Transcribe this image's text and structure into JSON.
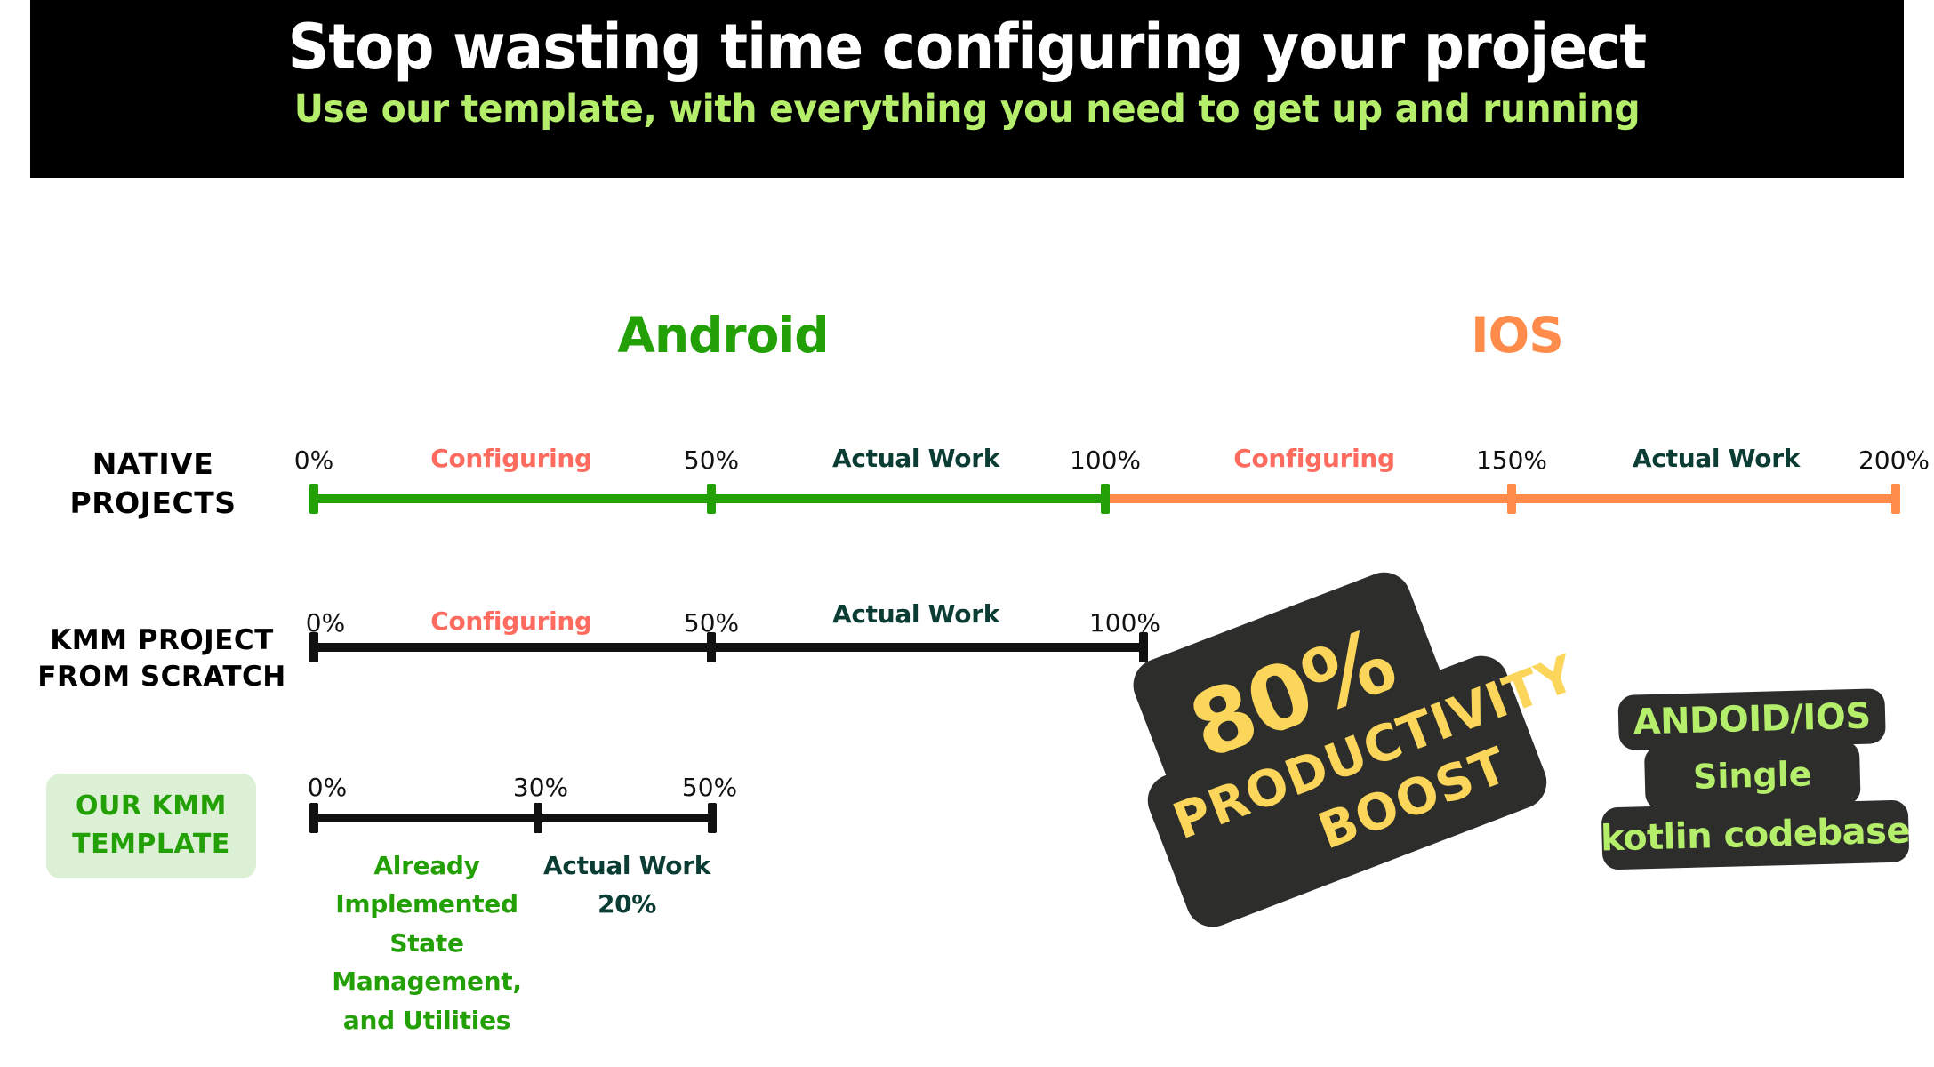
{
  "header": {
    "title": "Stop wasting time configuring your project",
    "subtitle": "Use our template, with everything you need to get up and running",
    "background_color": "#000000",
    "title_color": "#ffffff",
    "subtitle_color": "#B5EE6A"
  },
  "platforms": [
    {
      "name": "Android",
      "color": "#22A006"
    },
    {
      "name": "IOS",
      "color": "#FF8C4A"
    }
  ],
  "rows": [
    {
      "label": "NATIVE\nPROJECTS",
      "ticks": [
        "0%",
        "50%",
        "100%",
        "150%",
        "200%"
      ],
      "segments": [
        "Configuring",
        "Actual Work",
        "Configuring",
        "Actual Work"
      ]
    },
    {
      "label": "KMM PROJECT\nFROM SCRATCH",
      "ticks": [
        "0%",
        "50%",
        "100%"
      ],
      "segments": [
        "Configuring",
        "Actual Work"
      ]
    },
    {
      "label": "OUR KMM\nTEMPLATE",
      "ticks": [
        "0%",
        "30%",
        "50%"
      ],
      "segments": [
        "Already\nImplemented\nState\nManagement,\nand Utilities",
        "Actual Work\n20%"
      ]
    }
  ],
  "stickers": {
    "boost_percent": "80%",
    "boost_line1": "PRODUCTIVITY",
    "boost_line2": "BOOST",
    "codebase_line1": "ANDOID/IOS",
    "codebase_line2": "Single",
    "codebase_line3": "kotlin codebase",
    "dark_color": "#2D2D2B",
    "yellow_color": "#FBD65B",
    "green_color": "#B5EE6A"
  },
  "chart_data": {
    "type": "bar",
    "title": "Stop wasting time configuring your project",
    "subtitle": "Use our template, with everything you need to get up and running",
    "xlabel": "",
    "ylabel": "",
    "xlim": [
      0,
      200
    ],
    "grid": false,
    "legend_position": "none",
    "categories": [
      "NATIVE PROJECTS",
      "KMM PROJECT FROM SCRATCH",
      "OUR KMM TEMPLATE"
    ],
    "axis_ticks_percent": [
      0,
      30,
      50,
      100,
      150,
      200
    ],
    "series": [
      {
        "name": "NATIVE PROJECTS",
        "total_percent": 200,
        "segments": [
          {
            "label": "Configuring",
            "platform": "Android",
            "start": 0,
            "end": 50,
            "color": "#22A006"
          },
          {
            "label": "Actual Work",
            "platform": "Android",
            "start": 50,
            "end": 100,
            "color": "#22A006"
          },
          {
            "label": "Configuring",
            "platform": "IOS",
            "start": 100,
            "end": 150,
            "color": "#FF8C4A"
          },
          {
            "label": "Actual Work",
            "platform": "IOS",
            "start": 150,
            "end": 200,
            "color": "#FF8C4A"
          }
        ]
      },
      {
        "name": "KMM PROJECT FROM SCRATCH",
        "total_percent": 100,
        "segments": [
          {
            "label": "Configuring",
            "start": 0,
            "end": 50,
            "color": "#111111"
          },
          {
            "label": "Actual Work",
            "start": 50,
            "end": 100,
            "color": "#111111"
          }
        ]
      },
      {
        "name": "OUR KMM TEMPLATE",
        "total_percent": 50,
        "segments": [
          {
            "label": "Already Implemented State Management, and Utilities",
            "start": 0,
            "end": 30,
            "color": "#111111"
          },
          {
            "label": "Actual Work 20%",
            "start": 30,
            "end": 50,
            "color": "#111111"
          }
        ]
      }
    ],
    "annotations": [
      "80% PRODUCTIVITY BOOST",
      "ANDOID/IOS Single kotlin codebase"
    ]
  }
}
